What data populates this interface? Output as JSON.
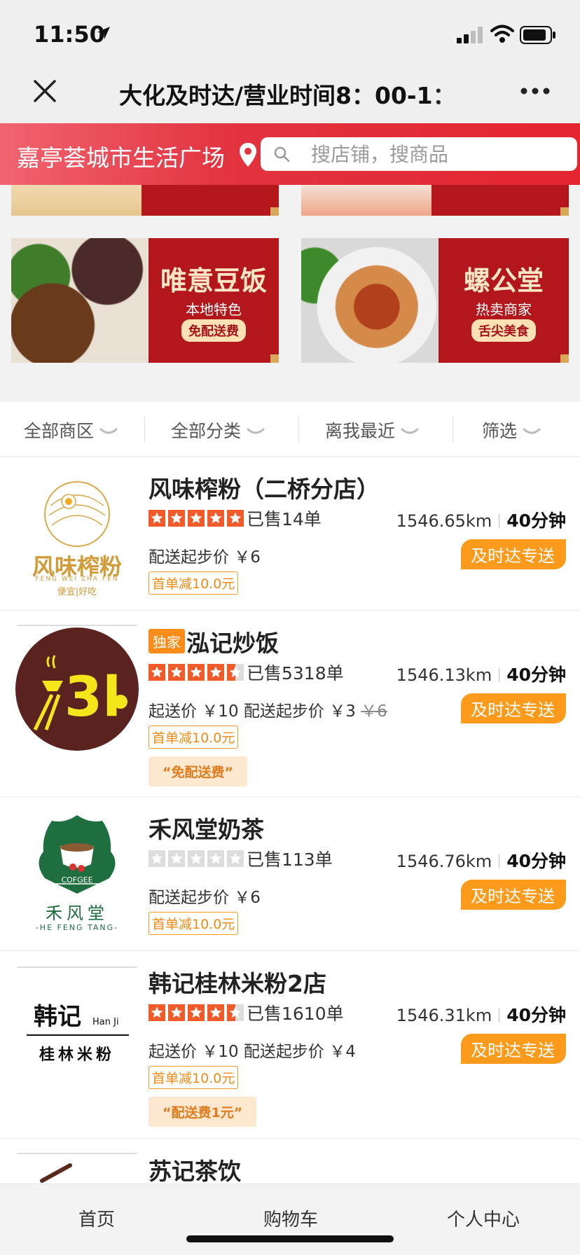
{
  "status_bar": {
    "time": "11:50"
  },
  "titlebar": {
    "title": "大化及时达/营业时间8：00-1："
  },
  "location_bar": {
    "place": "嘉亭荟城市生活广场"
  },
  "search": {
    "placeholder": "搜店铺，搜商品"
  },
  "banners": [
    {
      "title": "唯意豆饭",
      "subtitle": "本地特色",
      "tag": "免配送费"
    },
    {
      "title": "螺公堂",
      "subtitle": "热卖商家",
      "tag": "舌尖美食"
    }
  ],
  "filters": [
    "全部商区",
    "全部分类",
    "离我最近",
    "筛选"
  ],
  "shops": [
    {
      "name": "风味榨粉（二桥分店）",
      "rating": 5,
      "sold": "已售14单",
      "distance": "1546.65km",
      "time": "40分钟",
      "fee_text": "配送起步价 ￥6",
      "express": "及时达专送",
      "promo": "首单减10.0元",
      "logo_text": "风味榨粉",
      "logo_sub": "FENG WEI ZHA FEN",
      "logo_sub2": "便宜|好吃"
    },
    {
      "exclusive": "独家",
      "name": "泓记炒饭",
      "rating": 4.5,
      "sold": "已售5318单",
      "distance": "1546.13km",
      "time": "40分钟",
      "fee_text": "起送价 ￥10  配送起步价 ￥3",
      "fee_old": "￥6",
      "express": "及时达专送",
      "promo": "首单减10.0元",
      "free_ship": "“免配送费”"
    },
    {
      "name": "禾风堂奶茶",
      "rating": 0,
      "sold": "已售113单",
      "distance": "1546.76km",
      "time": "40分钟",
      "fee_text": "配送起步价 ￥6",
      "express": "及时达专送",
      "promo": "首单减10.0元",
      "logo_text": "禾风堂",
      "logo_sub": "-HE FENG TANG-",
      "logo_badge": "COFGEE"
    },
    {
      "name": "韩记桂林米粉2店",
      "rating": 4.5,
      "sold": "已售1610单",
      "distance": "1546.31km",
      "time": "40分钟",
      "fee_text": "起送价 ￥10  配送起步价 ￥4",
      "express": "及时达专送",
      "promo": "首单减10.0元",
      "free_ship": "“配送费1元”",
      "logo_text": "韩记",
      "logo_sub": "Han Ji",
      "logo_sub2": "桂林米粉"
    },
    {
      "name": "苏记茶饮"
    }
  ],
  "bottom_nav": [
    "首页",
    "购物车",
    "个人中心"
  ],
  "colors": {
    "brand_red": "#e32530",
    "accent_orange": "#fb9a1b",
    "star": "#f15a29"
  }
}
